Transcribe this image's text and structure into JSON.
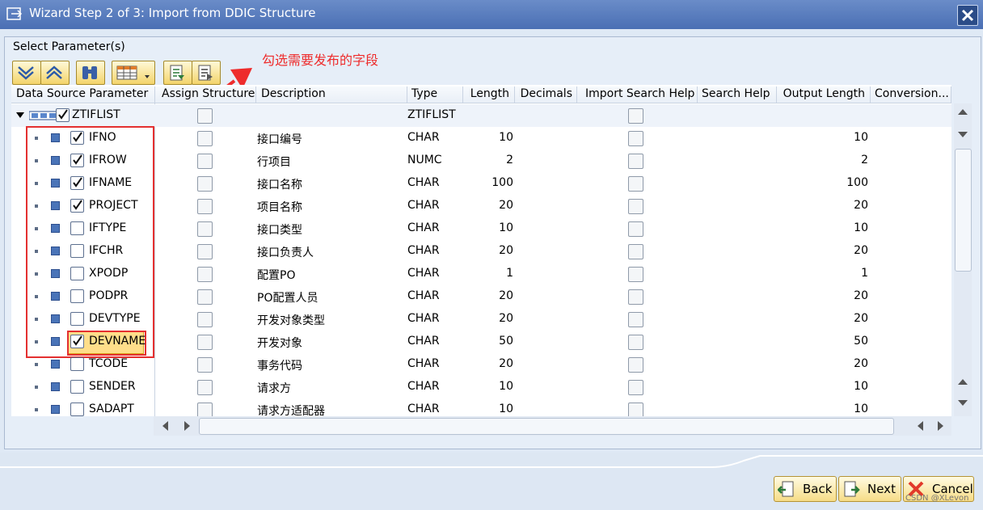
{
  "window": {
    "title": "Wizard Step 2 of 3: Import from DDIC Structure"
  },
  "frame": {
    "title": "Select Parameter(s)"
  },
  "annotation": "勾选需要发布的字段",
  "columns": {
    "c1": "Data Source Parameter",
    "c2": "Assign Structure",
    "c3": "Description",
    "c4": "Type",
    "c5": "Length",
    "c6": "Decimals",
    "c7": "Import Search Help",
    "c8": "Search Help",
    "c9": "Output Length",
    "c10": "Conversion..."
  },
  "root": {
    "name": "ZTIFLIST",
    "type": "ZTIFLIST"
  },
  "rows": [
    {
      "name": "IFNO",
      "desc": "接口编号",
      "type": "CHAR",
      "length": "10",
      "out": "10",
      "checked": true
    },
    {
      "name": "IFROW",
      "desc": "行项目",
      "type": "NUMC",
      "length": "2",
      "out": "2",
      "checked": true
    },
    {
      "name": "IFNAME",
      "desc": "接口名称",
      "type": "CHAR",
      "length": "100",
      "out": "100",
      "checked": true
    },
    {
      "name": "PROJECT",
      "desc": "项目名称",
      "type": "CHAR",
      "length": "20",
      "out": "20",
      "checked": true
    },
    {
      "name": "IFTYPE",
      "desc": "接口类型",
      "type": "CHAR",
      "length": "10",
      "out": "10",
      "checked": false
    },
    {
      "name": "IFCHR",
      "desc": "接口负责人",
      "type": "CHAR",
      "length": "20",
      "out": "20",
      "checked": false
    },
    {
      "name": "XPODP",
      "desc": "配置PO",
      "type": "CHAR",
      "length": "1",
      "out": "1",
      "checked": false
    },
    {
      "name": "PODPR",
      "desc": "PO配置人员",
      "type": "CHAR",
      "length": "20",
      "out": "20",
      "checked": false
    },
    {
      "name": "DEVTYPE",
      "desc": "开发对象类型",
      "type": "CHAR",
      "length": "20",
      "out": "20",
      "checked": false
    },
    {
      "name": "DEVNAME",
      "desc": "开发对象",
      "type": "CHAR",
      "length": "50",
      "out": "50",
      "checked": true
    },
    {
      "name": "TCODE",
      "desc": "事务代码",
      "type": "CHAR",
      "length": "20",
      "out": "20",
      "checked": false
    },
    {
      "name": "SENDER",
      "desc": "请求方",
      "type": "CHAR",
      "length": "10",
      "out": "10",
      "checked": false
    },
    {
      "name": "SADAPT",
      "desc": "请求方适配器",
      "type": "CHAR",
      "length": "10",
      "out": "10",
      "checked": false
    }
  ],
  "buttons": {
    "back": "Back",
    "next": "Next",
    "cancel": "Cancel"
  },
  "watermark": "CSDN @XLevon",
  "colors": {
    "title_bar": "#5a7dbf",
    "annotation": "#ee2c2c",
    "button": "#f6dc86"
  }
}
